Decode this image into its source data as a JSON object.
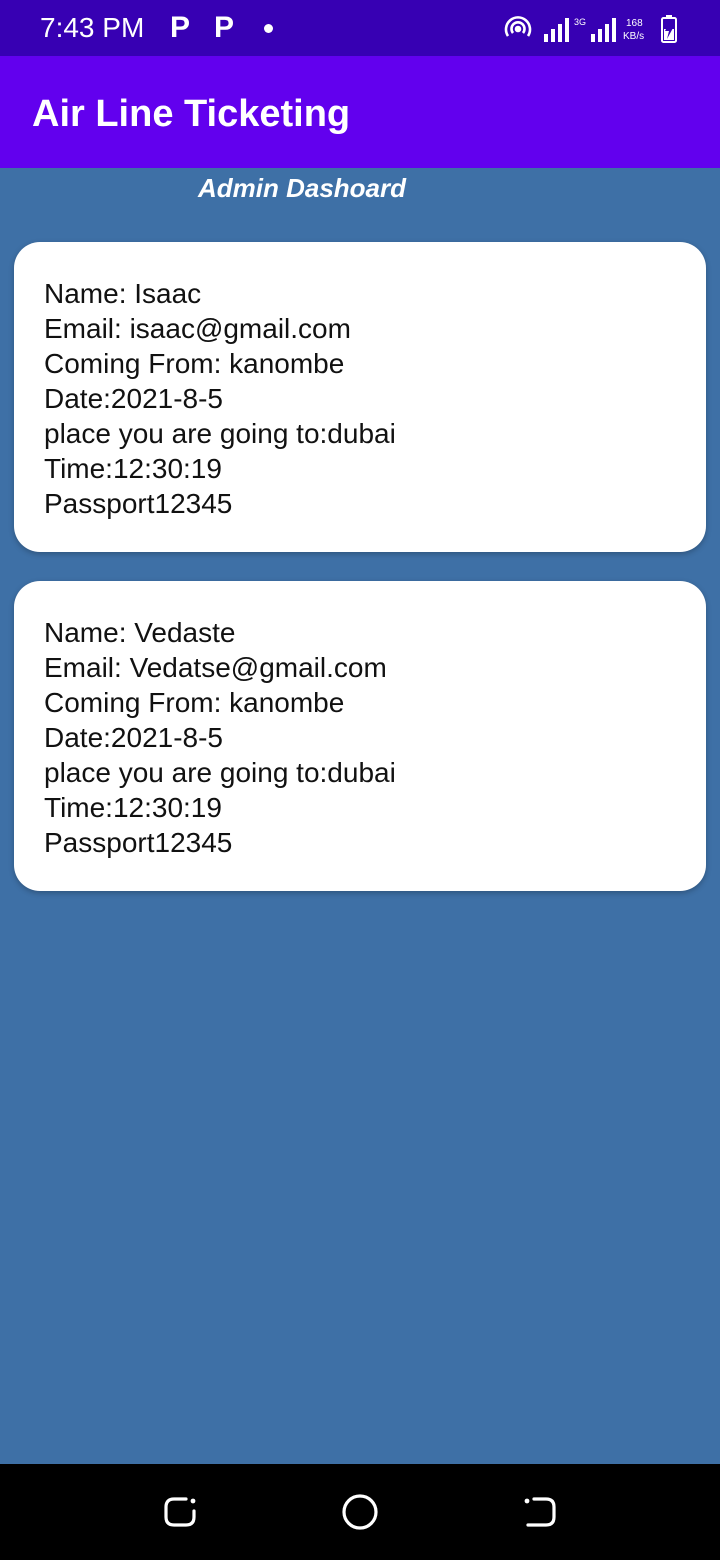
{
  "status_bar": {
    "time": "7:43 PM",
    "notification_icons": [
      "parking-p-icon",
      "parking-p-icon",
      "dot-icon"
    ],
    "network_type": "3G",
    "speed_value": "168",
    "speed_unit": "KB/s",
    "icons": [
      "hotspot-icon",
      "signal-icon",
      "signal-icon",
      "battery-charging-icon"
    ]
  },
  "app_bar": {
    "title": "Air Line Ticketing"
  },
  "dashboard": {
    "subtitle": "Admin Dashoard"
  },
  "tickets": [
    {
      "name": "Name: Isaac",
      "email": "Email: isaac@gmail.com",
      "coming_from": "Coming From: kanombe",
      "date": "Date:2021-8-5",
      "destination": "place you are going to:dubai",
      "time": "Time:12:30:19",
      "passport": "Passport12345"
    },
    {
      "name": "Name: Vedaste",
      "email": "Email: Vedatse@gmail.com",
      "coming_from": "Coming From: kanombe",
      "date": "Date:2021-8-5",
      "destination": "place you are going to:dubai",
      "time": "Time:12:30:19",
      "passport": "Passport12345"
    }
  ],
  "nav_bar": {
    "buttons": [
      "recent-apps-icon",
      "home-icon",
      "back-icon"
    ]
  },
  "colors": {
    "status_bar": "#3700b3",
    "app_bar": "#6200ee",
    "background": "#3e70a6",
    "card": "#ffffff",
    "nav_bar": "#000000"
  }
}
